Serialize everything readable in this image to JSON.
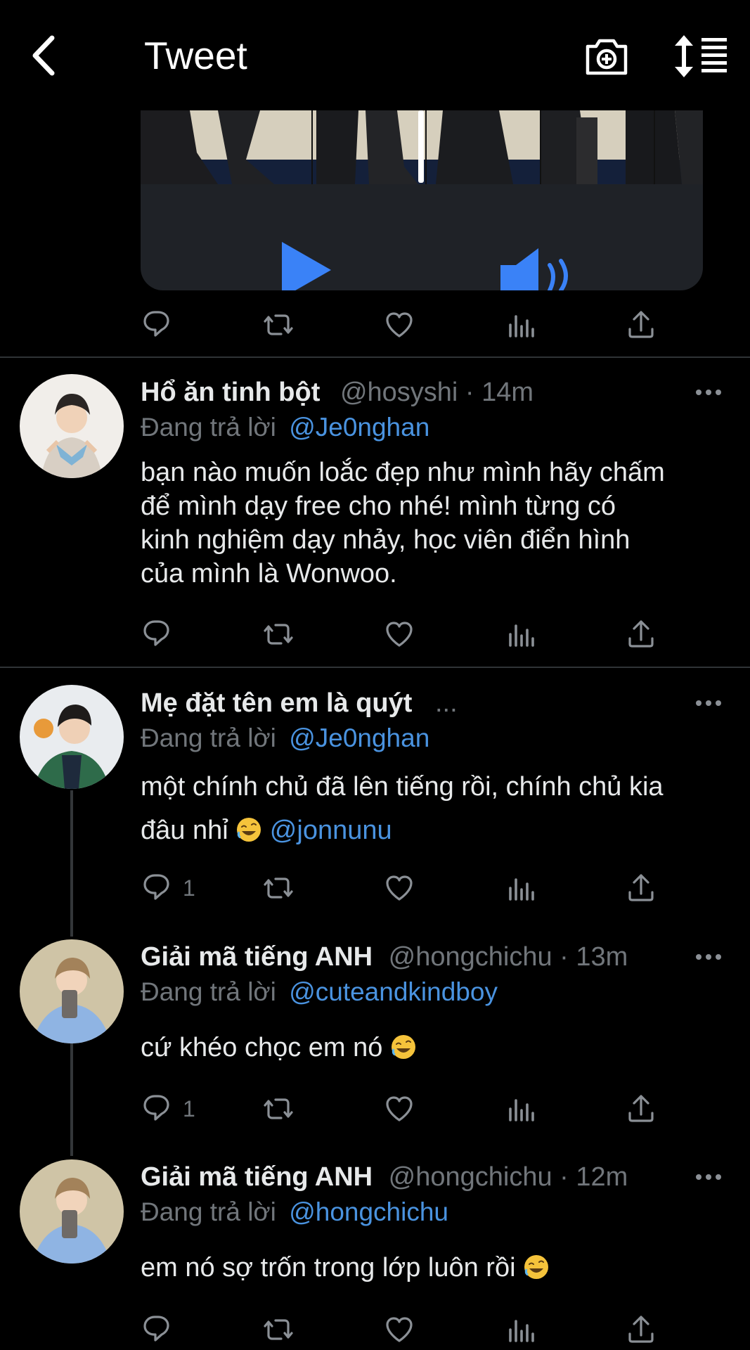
{
  "header": {
    "title": "Tweet",
    "back_icon": "chevron-left-icon",
    "camera_icon": "camera-plus-icon",
    "sort_icon": "sort-list-icon"
  },
  "media": {
    "play_icon": "play-icon",
    "volume_icon": "volume-icon"
  },
  "tweets": [
    {
      "name": "Hổ ăn tinh bột",
      "handle_time": "@hosyshi · 14m",
      "reply_prefix": "Đang trả lời",
      "reply_to": "@Je0nghan",
      "lines": [
        "bạn nào muốn loắc đẹp như mình hãy chấm",
        "để mình dạy free cho nhé! mình từng có",
        "kinh nghiệm dạy nhảy, học viên điển hình",
        "của mình là Wonwoo."
      ]
    },
    {
      "name": "Mẹ đặt tên em là quýt",
      "handle_time": "...",
      "reply_prefix": "Đang trả lời",
      "reply_to": "@Je0nghan",
      "line1": "một chính chủ đã lên tiếng rồi, chính chủ kia",
      "line2_text": "đâu nhỉ",
      "line2_mention": "@jonnunu",
      "reply_count": "1"
    },
    {
      "name": "Giải mã tiếng ANH",
      "handle_time": "@hongchichu · 13m",
      "reply_prefix": "Đang trả lời",
      "reply_to": "@cuteandkindboy",
      "text": "cứ khéo chọc em nó",
      "reply_count": "1"
    },
    {
      "name": "Giải mã tiếng ANH",
      "handle_time": "@hongchichu · 12m",
      "reply_prefix": "Đang trả lời",
      "reply_to": "@hongchichu",
      "text": "em nó sợ trốn trong lớp luôn rồi"
    }
  ],
  "colors": {
    "background": "#000000",
    "text": "#e7e9ea",
    "muted": "#71767b",
    "link": "#4a93e0",
    "divider": "#2f3336"
  }
}
